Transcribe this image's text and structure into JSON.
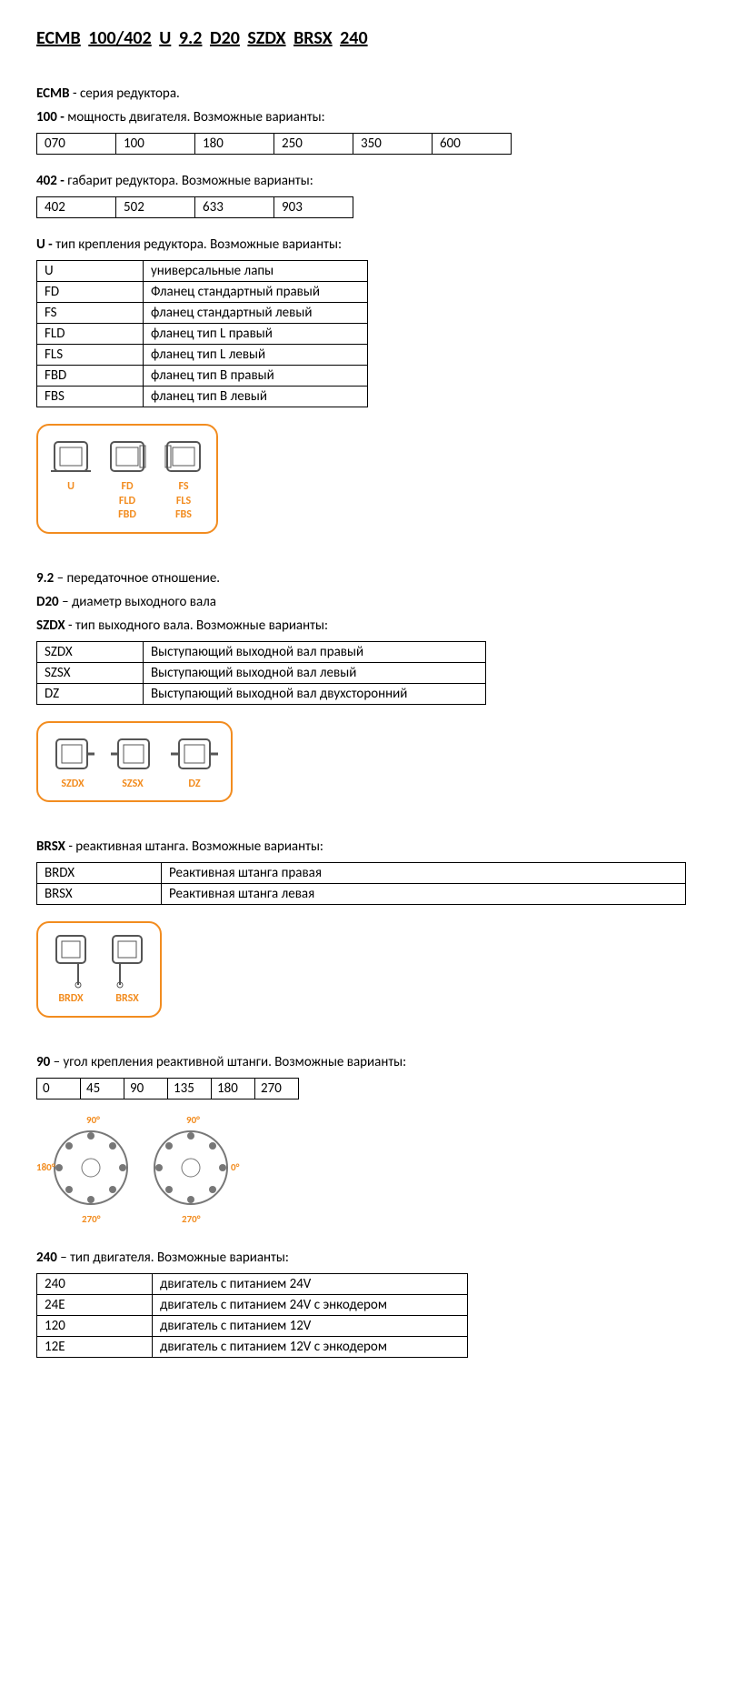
{
  "title": {
    "parts": [
      "ECMB",
      "100/402",
      "U",
      "9.2",
      "D20",
      "SZDX",
      "BRSX",
      "240"
    ]
  },
  "ecmb": {
    "code": "ECMB",
    "desc": "- серия редуктора."
  },
  "power": {
    "code": "100 -",
    "desc": "мощность двигателя. Возможные варианты:",
    "values": [
      "070",
      "100",
      "180",
      "250",
      "350",
      "600"
    ]
  },
  "size": {
    "code": "402 -",
    "desc": "габарит редуктора. Возможные варианты:",
    "values": [
      "402",
      "502",
      "633",
      "903"
    ]
  },
  "mount": {
    "code": "U -",
    "desc": "тип крепления редуктора. Возможные варианты:",
    "rows": [
      [
        "U",
        "универсальные лапы"
      ],
      [
        "FD",
        "Фланец стандартный правый"
      ],
      [
        "FS",
        "фланец стандартный левый"
      ],
      [
        "FLD",
        "фланец тип L правый"
      ],
      [
        "FLS",
        "фланец тип L левый"
      ],
      [
        "FBD",
        "фланец тип B правый"
      ],
      [
        "FBS",
        "фланец тип B левый"
      ]
    ],
    "diagram": [
      {
        "labels": [
          "U"
        ]
      },
      {
        "labels": [
          "FD",
          "FLD",
          "FBD"
        ]
      },
      {
        "labels": [
          "FS",
          "FLS",
          "FBS"
        ]
      }
    ]
  },
  "ratio": {
    "code": "9.2",
    "desc": "– передаточное отношение."
  },
  "diameter": {
    "code": "D20",
    "desc": "– диаметр выходного вала"
  },
  "shaft": {
    "code": "SZDX",
    "desc": "- тип выходного вала. Возможные варианты:",
    "rows": [
      [
        "SZDX",
        "Выступающий выходной вал правый"
      ],
      [
        "SZSX",
        "Выступающий выходной вал левый"
      ],
      [
        "DZ",
        "Выступающий выходной вал двухсторонний"
      ]
    ],
    "diagram": [
      "SZDX",
      "SZSX",
      "DZ"
    ]
  },
  "torque": {
    "code": "BRSX",
    "desc": "- реактивная штанга. Возможные варианты:",
    "rows": [
      [
        "BRDX",
        "Реактивная штанга правая"
      ],
      [
        "BRSX",
        "Реактивная штанга левая"
      ]
    ],
    "diagram": [
      "BRDX",
      "BRSX"
    ]
  },
  "angle": {
    "code": "90",
    "desc": "– угол крепления реактивной штанги. Возможные варианты:",
    "values": [
      "0",
      "45",
      "90",
      "135",
      "180",
      "270"
    ],
    "fig_labels": [
      "90°",
      "180°",
      "270°",
      "90°",
      "0°",
      "270°"
    ]
  },
  "motor": {
    "code": "240",
    "desc": "– тип двигателя. Возможные варианты:",
    "rows": [
      [
        "240",
        "двигатель с питанием 24V"
      ],
      [
        "24E",
        "двигатель с питанием 24V с энкодером"
      ],
      [
        "120",
        "двигатель с питанием 12V"
      ],
      [
        "12E",
        "двигатель с питанием 12V с энкодером"
      ]
    ]
  }
}
